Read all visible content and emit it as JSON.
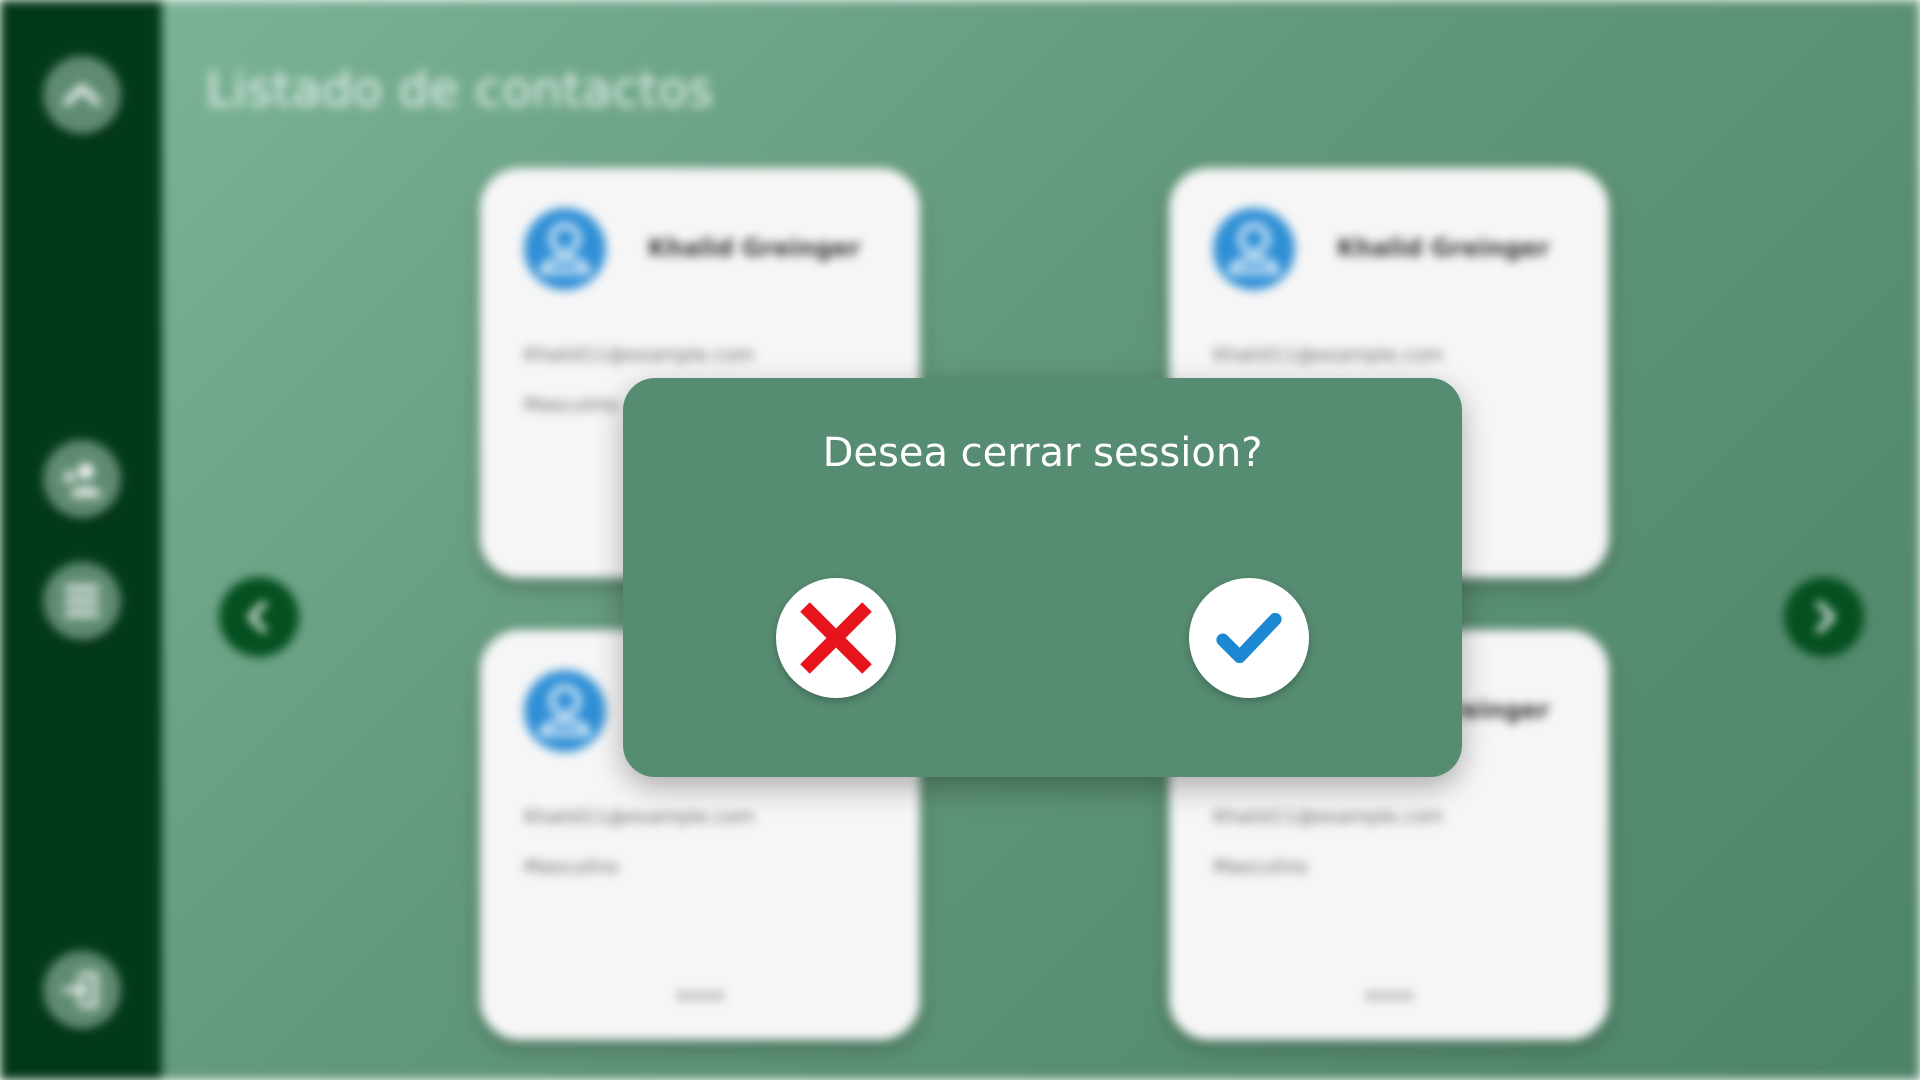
{
  "page": {
    "title": "Listado de contactos"
  },
  "sidebar": {
    "items": [
      {
        "icon": "chevron-up-icon"
      },
      {
        "icon": "add-user-icon"
      },
      {
        "icon": "list-icon"
      },
      {
        "icon": "logout-icon"
      }
    ]
  },
  "navigation": {
    "prev_icon": "chevron-left-icon",
    "next_icon": "chevron-right-icon"
  },
  "contacts": [
    {
      "name": "Khalid Greinger",
      "email": "Khalid11@example.com",
      "gender": "Masculino",
      "footer": ""
    },
    {
      "name": "Khalid Greinger",
      "email": "Khalid11@example.com",
      "gender": "",
      "footer": ""
    },
    {
      "name": "",
      "email": "Khalid11@example.com",
      "gender": "Masculino",
      "footer": "aaaaa"
    },
    {
      "name": "Khalid Greinger",
      "email": "Khalid11@example.com",
      "gender": "Masculino",
      "footer": "aaaaa"
    }
  ],
  "modal": {
    "question": "Desea cerrar session?",
    "cancel_icon": "cross-icon",
    "confirm_icon": "checkmark-icon"
  },
  "colors": {
    "sidebar": "#023a19",
    "modal": "#568c72",
    "avatar": "#2f8fd6",
    "cancel": "#e8141c",
    "confirm": "#1c88d4"
  }
}
